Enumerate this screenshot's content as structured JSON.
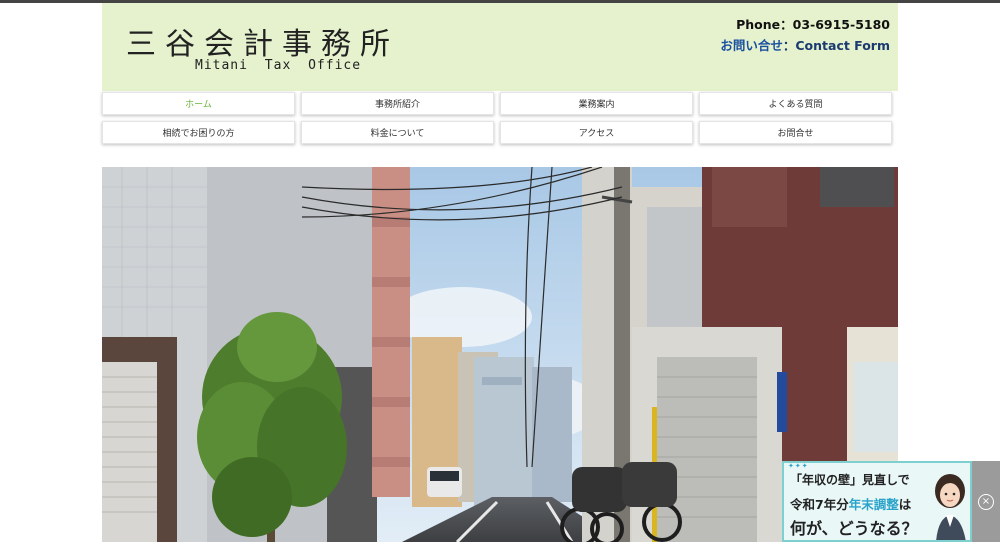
{
  "header": {
    "logo_jp": "三谷会計事務所",
    "logo_en": "Mitani Tax Office",
    "phone": "Phone：03-6915-5180",
    "contact_jp": "お問い合せ",
    "contact_sep": "：",
    "contact_en": "Contact Form"
  },
  "nav": {
    "row1": [
      "ホーム",
      "事務所紹介",
      "業務案内",
      "よくある質問"
    ],
    "row2": [
      "相続でお困りの方",
      "料金について",
      "アクセス",
      "お問合せ"
    ]
  },
  "banner": {
    "line1": "「年収の壁」見直しで",
    "line2_a": "令和7年分",
    "line2_b": "年末調整",
    "line2_c": "は",
    "line3": "何が、どうなる？",
    "close": "×"
  },
  "colors": {
    "header_bg": "#e5f2cd",
    "nav_active": "#6ab33c",
    "contact_link": "#1a4fa0",
    "banner_accent": "#29a3c9"
  }
}
